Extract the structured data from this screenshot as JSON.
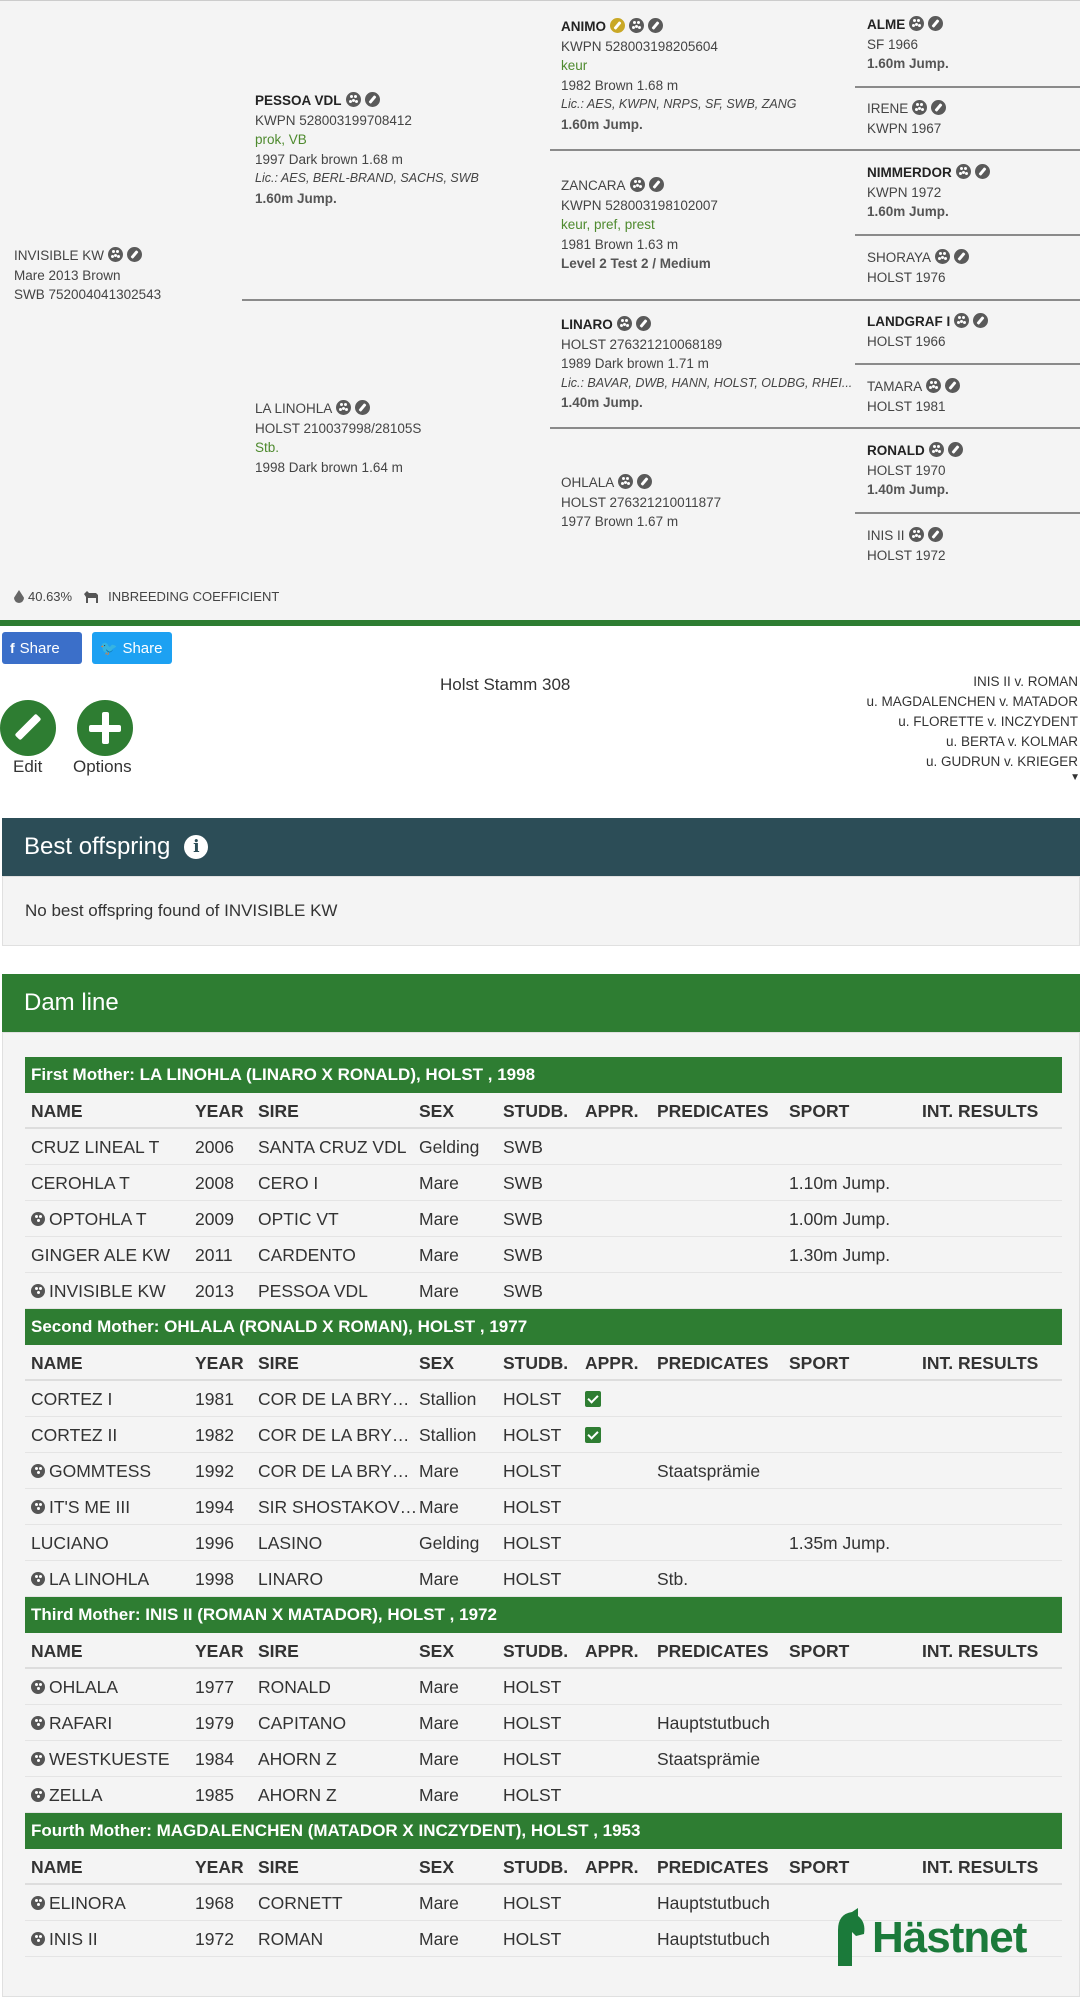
{
  "pedigree": {
    "subject": {
      "name": "INVISIBLE KW",
      "line1": "Mare 2013 Brown",
      "line2": "SWB 752004041302543"
    },
    "sire": {
      "name": "PESSOA VDL",
      "reg": "KWPN 528003199708412",
      "pred": "prok, VB",
      "info": "1997 Dark brown 1.68 m",
      "lic": "Lic.: AES, BERL-BRAND, SACHS, SWB",
      "sport": "1.60m Jump."
    },
    "dam": {
      "name": "LA LINOHLA",
      "reg": "HOLST 210037998/28105S",
      "pred": "Stb.",
      "info": "1998 Dark brown 1.64 m"
    },
    "ss": {
      "name": "ANIMO",
      "reg": "KWPN 528003198205604",
      "pred": "keur",
      "info": "1982 Brown 1.68 m",
      "lic": "Lic.: AES, KWPN, NRPS, SF, SWB, ZANG",
      "sport": "1.60m Jump."
    },
    "sd": {
      "name": "ZANCARA",
      "reg": "KWPN 528003198102007",
      "pred": "keur, pref, prest",
      "info": "1981 Brown 1.63 m",
      "sport": "Level 2 Test 2 / Medium"
    },
    "ds": {
      "name": "LINARO",
      "reg": "HOLST 276321210068189",
      "info": "1989 Dark brown 1.71 m",
      "lic": "Lic.: BAVAR, DWB, HANN, HOLST, OLDBG, RHEI...",
      "sport": "1.40m Jump."
    },
    "dd": {
      "name": "OHLALA",
      "reg": "HOLST 276321210011877",
      "info": "1977 Brown 1.67 m"
    },
    "sss": {
      "name": "ALME",
      "reg": "SF 1966",
      "sport": "1.60m Jump."
    },
    "ssd": {
      "name": "IRENE",
      "reg": "KWPN 1967"
    },
    "sds": {
      "name": "NIMMERDOR",
      "reg": "KWPN 1972",
      "sport": "1.60m Jump."
    },
    "sdd": {
      "name": "SHORAYA",
      "reg": "HOLST 1976"
    },
    "dss": {
      "name": "LANDGRAF I",
      "reg": "HOLST 1966"
    },
    "dsd": {
      "name": "TAMARA",
      "reg": "HOLST 1981"
    },
    "dds": {
      "name": "RONALD",
      "reg": "HOLST 1970",
      "sport": "1.40m Jump."
    },
    "ddd": {
      "name": "INIS II",
      "reg": "HOLST 1972"
    },
    "inbreeding_value": "40.63%",
    "inbreeding_label": "INBREEDING COEFFICIENT"
  },
  "share": {
    "facebook": "Share",
    "twitter": "Share"
  },
  "stamm": "Holst Stamm 308",
  "dam_chain": [
    "INIS II v. ROMAN",
    "u. MAGDALENCHEN v. MATADOR",
    "u. FLORETTE v. INCZYDENT",
    "u. BERTA v. KOLMAR",
    "u. GUDRUN v. KRIEGER"
  ],
  "actions": {
    "edit": "Edit",
    "options": "Options"
  },
  "best_offspring": {
    "title": "Best offspring",
    "message": "No best offspring found of INVISIBLE KW"
  },
  "dam_line": {
    "title": "Dam line",
    "headers": {
      "name": "NAME",
      "year": "YEAR",
      "sire": "SIRE",
      "sex": "SEX",
      "stud": "STUDB.",
      "appr": "APPR.",
      "pred": "PREDICATES",
      "sport": "SPORT",
      "int": "INT. RESULTS"
    },
    "mothers": [
      {
        "title": "First Mother: LA LINOHLA (LINARO X RONALD), HOLST , 1998",
        "rows": [
          {
            "fam": false,
            "name": "CRUZ LINEAL T",
            "year": "2006",
            "sire": "SANTA CRUZ VDL",
            "sex": "Gelding",
            "stud": "SWB",
            "appr": false,
            "pred": "",
            "sport": ""
          },
          {
            "fam": false,
            "name": "CEROHLA T",
            "year": "2008",
            "sire": "CERO I",
            "sex": "Mare",
            "stud": "SWB",
            "appr": false,
            "pred": "",
            "sport": "1.10m Jump."
          },
          {
            "fam": true,
            "name": "OPTOHLA T",
            "year": "2009",
            "sire": "OPTIC VT",
            "sex": "Mare",
            "stud": "SWB",
            "appr": false,
            "pred": "",
            "sport": "1.00m Jump."
          },
          {
            "fam": false,
            "name": "GINGER ALE KW",
            "year": "2011",
            "sire": "CARDENTO",
            "sex": "Mare",
            "stud": "SWB",
            "appr": false,
            "pred": "",
            "sport": "1.30m Jump."
          },
          {
            "fam": true,
            "name": "INVISIBLE KW",
            "year": "2013",
            "sire": "PESSOA VDL",
            "sex": "Mare",
            "stud": "SWB",
            "appr": false,
            "pred": "",
            "sport": ""
          }
        ]
      },
      {
        "title": "Second Mother: OHLALA (RONALD X ROMAN), HOLST , 1977",
        "rows": [
          {
            "fam": false,
            "name": "CORTEZ I",
            "year": "1981",
            "sire": "COR DE LA BRYE...",
            "sex": "Stallion",
            "stud": "HOLST",
            "appr": true,
            "pred": "",
            "sport": ""
          },
          {
            "fam": false,
            "name": "CORTEZ II",
            "year": "1982",
            "sire": "COR DE LA BRYE...",
            "sex": "Stallion",
            "stud": "HOLST",
            "appr": true,
            "pred": "",
            "sport": ""
          },
          {
            "fam": true,
            "name": "GOMMTESS",
            "year": "1992",
            "sire": "COR DE LA BRYE...",
            "sex": "Mare",
            "stud": "HOLST",
            "appr": false,
            "pred": "Staatsprämie",
            "sport": ""
          },
          {
            "fam": true,
            "name": "IT'S ME III",
            "year": "1994",
            "sire": "SIR SHOSTAKOVI...",
            "sex": "Mare",
            "stud": "HOLST",
            "appr": false,
            "pred": "",
            "sport": ""
          },
          {
            "fam": false,
            "name": "LUCIANO",
            "year": "1996",
            "sire": "LASINO",
            "sex": "Gelding",
            "stud": "HOLST",
            "appr": false,
            "pred": "",
            "sport": "1.35m Jump."
          },
          {
            "fam": true,
            "name": "LA LINOHLA",
            "year": "1998",
            "sire": "LINARO",
            "sex": "Mare",
            "stud": "HOLST",
            "appr": false,
            "pred": "Stb.",
            "sport": ""
          }
        ]
      },
      {
        "title": "Third Mother: INIS II (ROMAN X MATADOR), HOLST , 1972",
        "rows": [
          {
            "fam": true,
            "name": "OHLALA",
            "year": "1977",
            "sire": "RONALD",
            "sex": "Mare",
            "stud": "HOLST",
            "appr": false,
            "pred": "",
            "sport": ""
          },
          {
            "fam": true,
            "name": "RAFARI",
            "year": "1979",
            "sire": "CAPITANO",
            "sex": "Mare",
            "stud": "HOLST",
            "appr": false,
            "pred": "Hauptstutbuch",
            "sport": ""
          },
          {
            "fam": true,
            "name": "WESTKUESTE",
            "year": "1984",
            "sire": "AHORN Z",
            "sex": "Mare",
            "stud": "HOLST",
            "appr": false,
            "pred": "Staatsprämie",
            "sport": ""
          },
          {
            "fam": true,
            "name": "ZELLA",
            "year": "1985",
            "sire": "AHORN Z",
            "sex": "Mare",
            "stud": "HOLST",
            "appr": false,
            "pred": "",
            "sport": ""
          }
        ]
      },
      {
        "title": "Fourth Mother: MAGDALENCHEN (MATADOR X INCZYDENT), HOLST , 1953",
        "rows": [
          {
            "fam": true,
            "name": "ELINORA",
            "year": "1968",
            "sire": "CORNETT",
            "sex": "Mare",
            "stud": "HOLST",
            "appr": false,
            "pred": "Hauptstutbuch",
            "sport": ""
          },
          {
            "fam": true,
            "name": "INIS II",
            "year": "1972",
            "sire": "ROMAN",
            "sex": "Mare",
            "stud": "HOLST",
            "appr": false,
            "pred": "Hauptstutbuch",
            "sport": ""
          }
        ]
      }
    ]
  },
  "logo": {
    "text": "Hästnet",
    "color": "#1b7a3a"
  },
  "colors": {
    "green": "#2e7d32",
    "teal": "#2c4d57",
    "facebook": "#3b6fc9",
    "twitter": "#1da1f2"
  }
}
